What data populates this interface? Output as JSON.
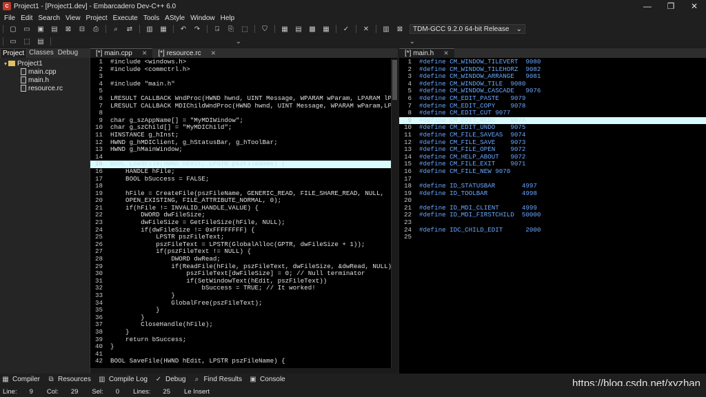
{
  "window": {
    "title": "Project1 - [Project1.dev] - Embarcadero Dev-C++ 6.0",
    "minimize": "—",
    "maximize": "❐",
    "close": "✕"
  },
  "menu": [
    "File",
    "Edit",
    "Search",
    "View",
    "Project",
    "Execute",
    "Tools",
    "AStyle",
    "Window",
    "Help"
  ],
  "toolbar": {
    "compiler": "TDM-GCC 9.2.0 64-bit Release"
  },
  "left_panel": {
    "tabs": [
      "Project",
      "Classes",
      "Debug"
    ],
    "project_name": "Project1",
    "files": [
      "main.cpp",
      "main.h",
      "resource.rc"
    ]
  },
  "left_editor": {
    "tabs": [
      "[*] main.cpp",
      "[*] resource.rc"
    ],
    "lines": [
      "#include <windows.h>",
      "#include <commctrl.h>",
      "",
      "#include \"main.h\"",
      "",
      "LRESULT CALLBACK WndProc(HWND hwnd, UINT Message, WPARAM wParam, LPARAM lParam);",
      "LRESULT CALLBACK MDIChildWndProc(HWND hwnd, UINT Message, WPARAM wParam,LPARAM lPara",
      "",
      "char g_szAppName[] = \"MyMDIWindow\";",
      "char g_szChild[] = \"MyMDIChild\";",
      "HINSTANCE g_hInst;",
      "HWND g_hMDIClient, g_hStatusBar, g_hToolBar;",
      "HWND g_hMainWindow;",
      "",
      "BOOL LoadFile(HWND hEdit, LPSTR pszFileName) {",
      "    HANDLE hFile;",
      "    BOOL bSuccess = FALSE;",
      "",
      "    hFile = CreateFile(pszFileName, GENERIC_READ, FILE_SHARE_READ, NULL,",
      "    OPEN_EXISTING, FILE_ATTRIBUTE_NORMAL, 0);",
      "    if(hFile != INVALID_HANDLE_VALUE) {",
      "        DWORD dwFileSize;",
      "        dwFileSize = GetFileSize(hFile, NULL);",
      "        if(dwFileSize != 0xFFFFFFFF) {",
      "            LPSTR pszFileText;",
      "            pszFileText = LPSTR(GlobalAlloc(GPTR, dwFileSize + 1));",
      "            if(pszFileText != NULL) {",
      "                DWORD dwRead;",
      "                if(ReadFile(hFile, pszFileText, dwFileSize, &dwRead, NULL)) {",
      "                    pszFileText[dwFileSize] = 0; // Null terminator",
      "                    if(SetWindowText(hEdit, pszFileText))",
      "                        bSuccess = TRUE; // It worked!",
      "                }",
      "                GlobalFree(pszFileText);",
      "            }",
      "        }",
      "        CloseHandle(hFile);",
      "    }",
      "    return bSuccess;",
      "}",
      "",
      "BOOL SaveFile(HWND hEdit, LPSTR pszFileName) {"
    ],
    "highlight_line": 15
  },
  "right_editor": {
    "tabs": [
      "[*] main.h"
    ],
    "lines": [
      "#define CM_WINDOW_TILEVERT  9080",
      "#define CM_WINDOW_TILEHORZ  9082",
      "#define CM_WINDOW_ARRANGE   9081",
      "#define CM_WINDOW_TILE  9080",
      "#define CM_WINDOW_CASCADE   9076",
      "#define CM_EDIT_PASTE   9079",
      "#define CM_EDIT_COPY    9078",
      "#define CM_EDIT_CUT 9077",
      "#define CM_EDIT_REDO    9076",
      "#define CM_EDIT_UNDO    9075",
      "#define CM_FILE_SAVEAS  9074",
      "#define CM_FILE_SAVE    9073",
      "#define CM_FILE_OPEN    9072",
      "#define CM_HELP_ABOUT   9072",
      "#define CM_FILE_EXIT    9071",
      "#define CM_FILE_NEW 9070",
      "",
      "#define ID_STATUSBAR       4997",
      "#define ID_TOOLBAR         4998",
      "",
      "#define ID_MDI_CLIENT      4999",
      "#define ID_MDI_FIRSTCHILD  50000",
      "",
      "#define IDC_CHILD_EDIT      2000",
      ""
    ],
    "highlight_line": 9
  },
  "bottom_tabs": [
    "Compiler",
    "Resources",
    "Compile Log",
    "Debug",
    "Find Results",
    "Console"
  ],
  "status": {
    "line_label": "Line:",
    "line": "9",
    "col_label": "Col:",
    "col": "29",
    "sel_label": "Sel:",
    "sel": "0",
    "lines_label": "Lines:",
    "lines": "25",
    "mode": "Le Insert"
  },
  "watermark": "https://blog.csdn.net/xyzhan"
}
